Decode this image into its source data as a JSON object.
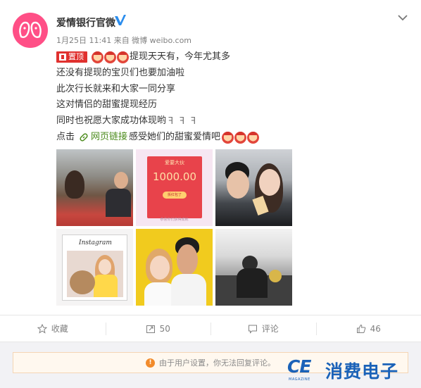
{
  "post": {
    "username": "爱情银行官微",
    "verified": true,
    "meta": "1月25日 11:41 来自 微博 weibo.com",
    "pin_label": "置顶",
    "lines": [
      "提现天天有，今年尤其多",
      "还没有提现的宝贝们也要加油啦",
      "此次行长就来和大家一同分享",
      "这对情侣的甜蜜提现经历",
      "同时也祝愿大家成功体现哟"
    ],
    "last_line_prefix": "点击",
    "link_text": "网页链接",
    "last_line_suffix": "感受她们的甜蜜爱情吧",
    "photos": {
      "red_packet_top": "爱要大伙",
      "red_packet_amount": "1000.00",
      "red_packet_button": "拆红包了",
      "red_packet_footer": "恭喜你们获得成就",
      "insta_title": "Instagram"
    }
  },
  "actions": {
    "favorite": "收藏",
    "repost": "50",
    "comment": "评论",
    "like": "46"
  },
  "reply_notice": "由于用户设置，你无法回复评论。",
  "watermark": {
    "logo": "CE",
    "logo_sub": "MAGAZINE",
    "text": "消费电子"
  },
  "colors": {
    "pin": "#e0312f",
    "link": "#4b8b1c",
    "avatar": "#ff4f86",
    "watermark": "#1a62b8",
    "verified": "#2b8ded"
  }
}
